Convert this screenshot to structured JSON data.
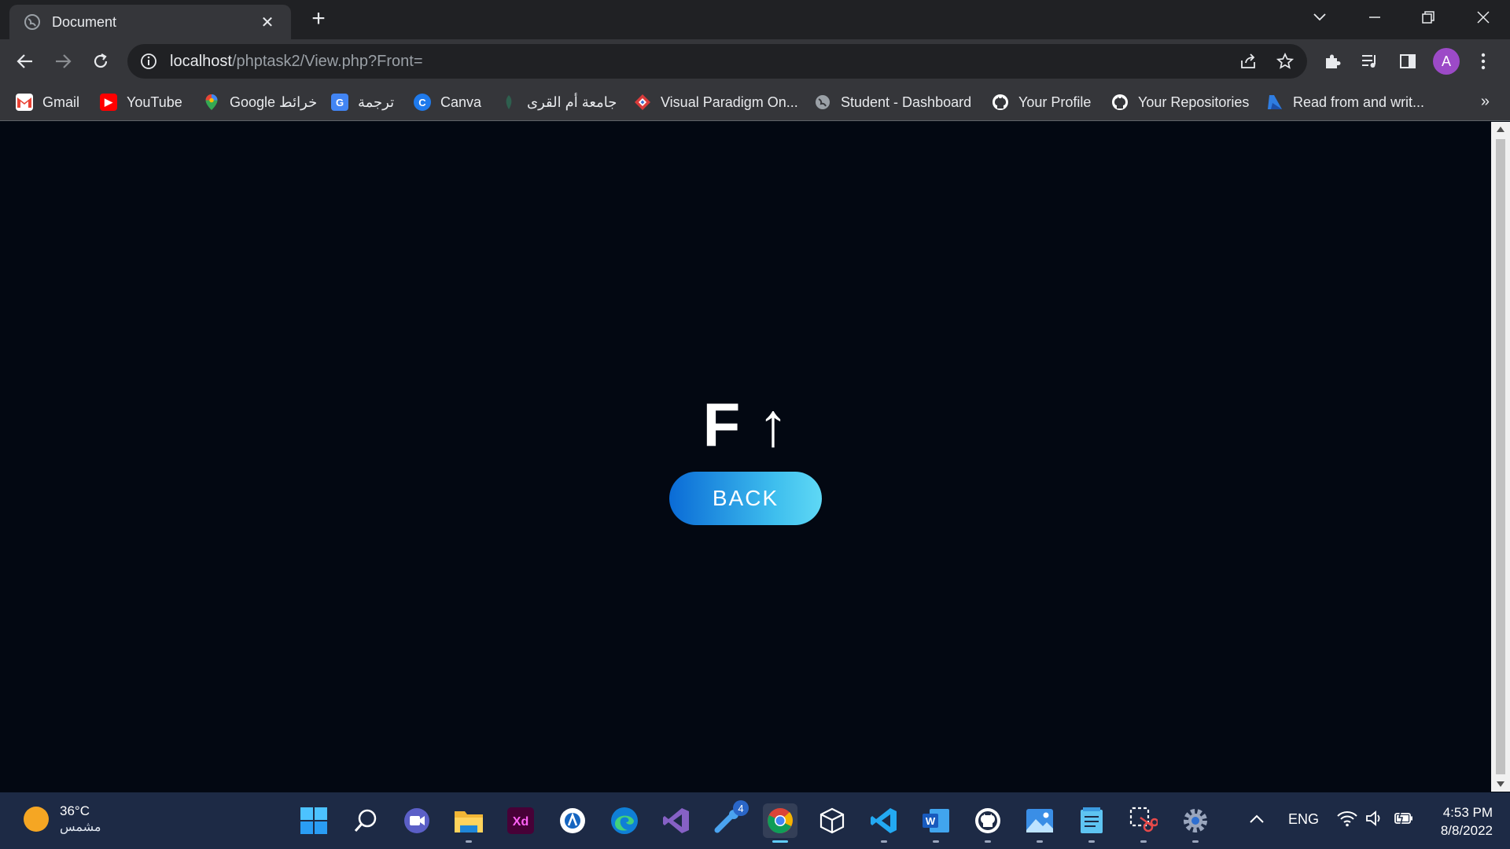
{
  "browser": {
    "tab_title": "Document",
    "url_host": "localhost",
    "url_path": "/phptask2/View.php?Front=",
    "profile_initial": "A",
    "bookmarks": [
      {
        "label": "Gmail",
        "icon": "gmail-icon",
        "color": "#ea4335"
      },
      {
        "label": "YouTube",
        "icon": "youtube-icon",
        "color": "#ff0000"
      },
      {
        "label": "Google خرائط",
        "icon": "google-maps-icon",
        "color": "#34a853"
      },
      {
        "label": "ترجمة",
        "icon": "google-translate-icon",
        "color": "#4285f4"
      },
      {
        "label": "Canva",
        "icon": "canva-icon",
        "color": "#1f7aec"
      },
      {
        "label": "جامعة أم القرى",
        "icon": "university-icon",
        "color": "#2e7d62"
      },
      {
        "label": "Visual Paradigm On...",
        "icon": "visual-paradigm-icon",
        "color": "#d93b3b"
      },
      {
        "label": "Student - Dashboard",
        "icon": "globe-icon",
        "color": "#9aa0a6"
      },
      {
        "label": "Your Profile",
        "icon": "github-icon",
        "color": "#ffffff"
      },
      {
        "label": "Your Repositories",
        "icon": "github-icon",
        "color": "#ffffff"
      },
      {
        "label": "Read from and writ...",
        "icon": "azure-icon",
        "color": "#2f7de1"
      }
    ]
  },
  "page": {
    "letter": "F",
    "arrow": "↑",
    "back_label": "BACK",
    "back_gradient_start": "#0a6bd6",
    "back_gradient_end": "#5fd8f5",
    "background": "#030812"
  },
  "taskbar": {
    "weather_temp": "36°C",
    "weather_condition": "مشمس",
    "steam_badge": "4",
    "language": "ENG",
    "time": "4:53 PM",
    "date": "8/8/2022",
    "apps": [
      "windows-start-icon",
      "search-icon",
      "teams-icon",
      "file-explorer-icon",
      "adobe-xd-icon",
      "app-icon",
      "edge-icon",
      "visual-studio-icon",
      "steam-icon",
      "chrome-icon",
      "virtualbox-icon",
      "vscode-icon",
      "word-icon",
      "github-desktop-icon",
      "photos-icon",
      "notepad-icon",
      "snipping-tool-icon",
      "settings-icon"
    ]
  }
}
